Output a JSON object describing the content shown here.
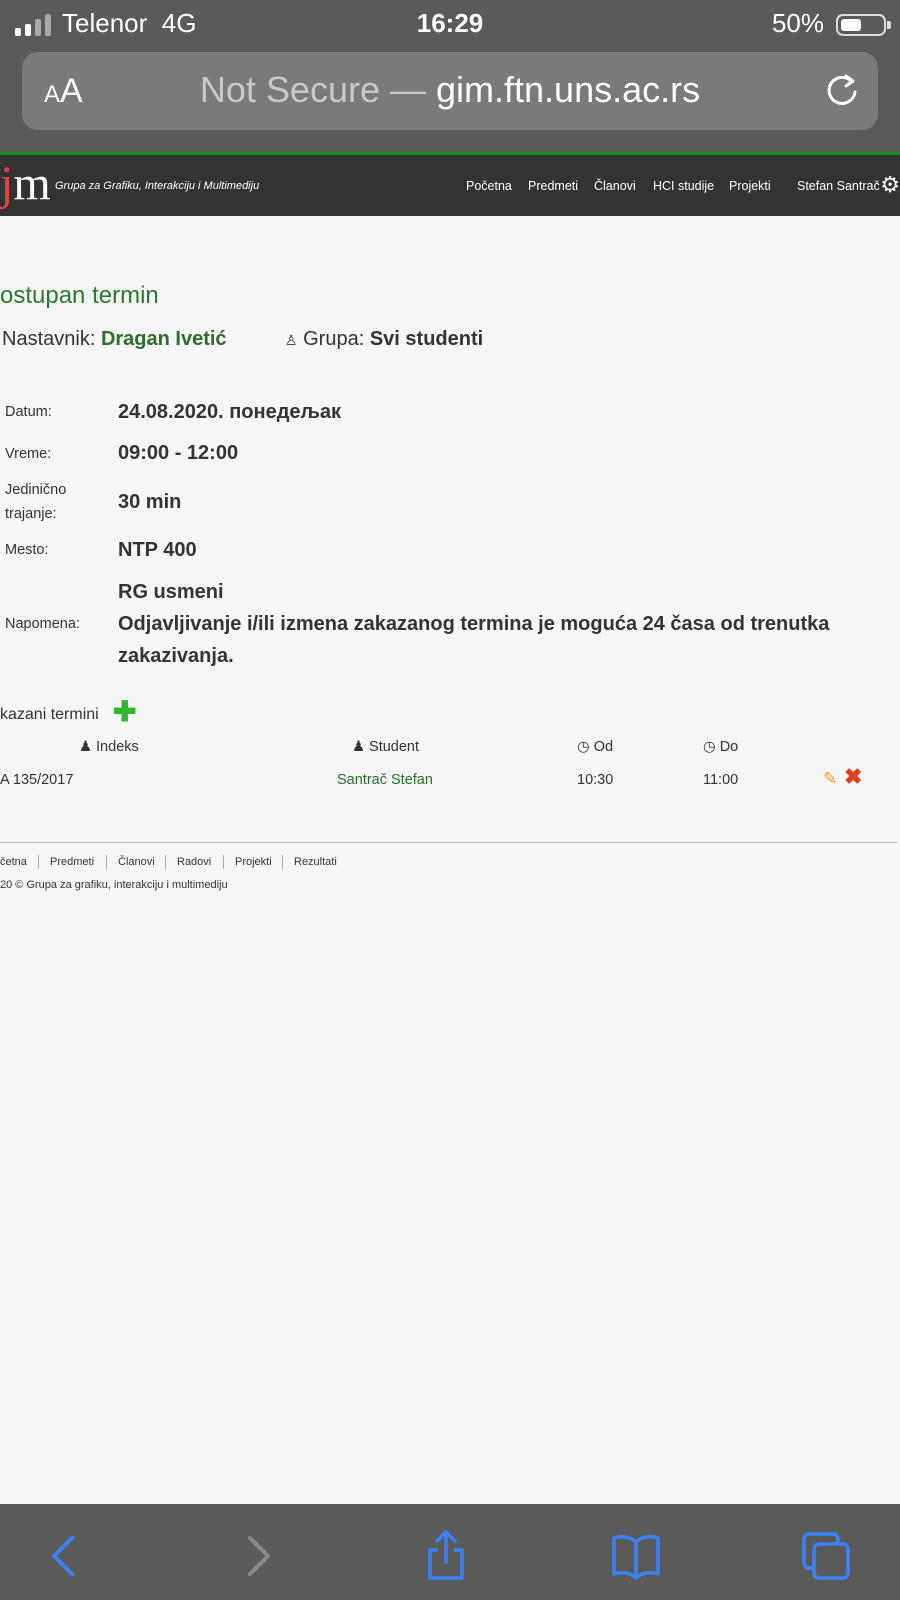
{
  "status_bar": {
    "carrier": "Telenor",
    "network": "4G",
    "time": "16:29",
    "battery": "50%"
  },
  "browser": {
    "text_size_button": "AA",
    "not_secure": "Not Secure",
    "separator": "—",
    "domain": "gim.ftn.uns.ac.rs"
  },
  "site": {
    "logo": "gim",
    "tagline": "Grupa za Grafiku, Interakciju i Multimediju",
    "nav": [
      "Početna",
      "Predmeti",
      "Članovi",
      "HCI studije",
      "Projekti"
    ],
    "user": "Stefan Santrač"
  },
  "page": {
    "title": "ostupan termin",
    "teacher_label": "Nastavnik:",
    "teacher": "Dragan Ivetić",
    "group_label": "Grupa:",
    "group": "Svi studenti"
  },
  "details": {
    "date_label": "Datum:",
    "date": "24.08.2020. понедељак",
    "time_label": "Vreme:",
    "time": "09:00 - 12:00",
    "duration_label_1": "Jedinično",
    "duration_label_2": "trajanje:",
    "duration": "30 min",
    "place_label": "Mesto:",
    "place": "NTP 400",
    "note_label": "Napomena:",
    "note_1": "RG usmeni",
    "note_2": "Odjavljivanje i/ili izmena zakazanog termina je moguća 24 časa od trenutka",
    "note_3": "zakazivanja."
  },
  "appointments": {
    "title": "kazani termini",
    "columns": {
      "index": "Indeks",
      "student": "Student",
      "from": "Od",
      "to": "Do"
    },
    "rows": [
      {
        "index": "A 135/2017",
        "student": "Santrač Stefan",
        "from": "10:30",
        "to": "11:00"
      }
    ]
  },
  "footer": {
    "links": [
      "četna",
      "Predmeti",
      "Članovi",
      "Radovi",
      "Projekti",
      "Rezultati"
    ],
    "copyright": "20 © Grupa za grafiku, interakciju i multimediju"
  },
  "colors": {
    "accent_green": "#2a7a2a",
    "header_bg": "#333333",
    "ios_bar": "#5a5a5a",
    "ios_blue": "#3b82f6"
  }
}
